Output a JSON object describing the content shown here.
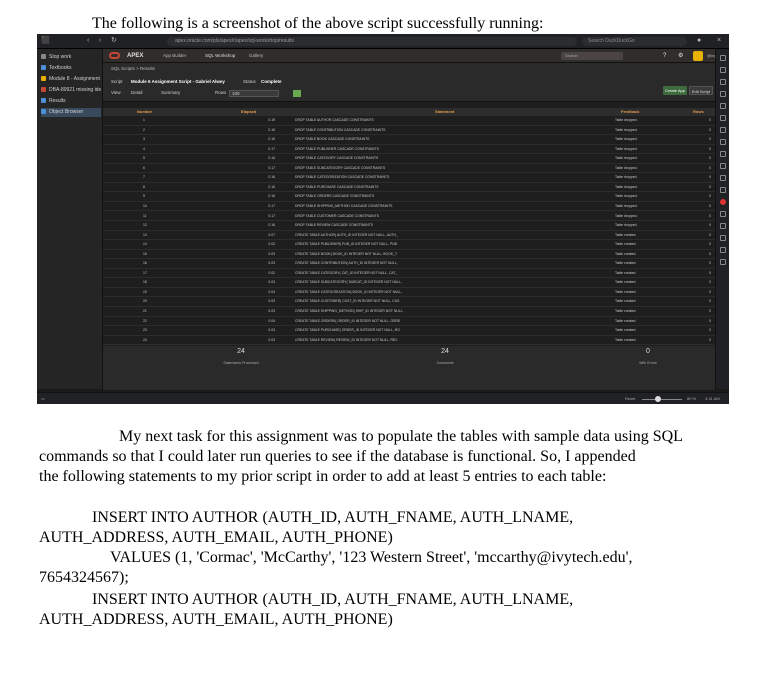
{
  "document": {
    "intro_line": "The following is a screenshot of the above script successfully running:",
    "paragraph_lines": [
      "My next task for this assignment was to populate the tables with sample data using SQL",
      "commands so that I could later run queries to see if the database is functional.  So, I appended",
      "the following statements to my prior script in order to add at least 5 entries to each table:"
    ],
    "code_lines": [
      "INSERT INTO AUTHOR (AUTH_ID, AUTH_FNAME, AUTH_LNAME,",
      "AUTH_ADDRESS, AUTH_EMAIL, AUTH_PHONE)",
      "VALUES (1, 'Cormac', 'McCarthy', '123 Western Street', 'mccarthy@ivytech.edu',",
      "7654324567);",
      "INSERT INTO AUTHOR (AUTH_ID, AUTH_FNAME, AUTH_LNAME,",
      "AUTH_ADDRESS, AUTH_EMAIL, AUTH_PHONE)"
    ]
  },
  "screenshot": {
    "browser": {
      "url": "apex.oracle.com/pls/apex/r/apex/sql-workshop/results",
      "search_placeholder": "Search DuckDuckGo",
      "workspace": "Stop work",
      "zoom": "80 %",
      "time": "3:31 AM"
    },
    "left_rail": {
      "items": [
        "Stop work",
        "Textbooks",
        "Module 8 - Assignment - S",
        "DBA-89921 missing ident",
        "Results",
        "Object Browser"
      ],
      "selected_index": 5
    },
    "apex": {
      "brand": "APEX",
      "nav": [
        "App Builder",
        "SQL Workshop",
        "Gallery"
      ],
      "search_placeholder": "Search",
      "user": "@ivytech.edu"
    },
    "breadcrumb": "SQL Scripts   >   Results",
    "meta": {
      "script_label": "Script",
      "script_value": "Module 6 Assignment Script - Gabriel Alwey",
      "status_label": "Status",
      "status_value": "Complete",
      "view_label": "View",
      "view_options": [
        "Detail",
        "Summary"
      ],
      "rows_label": "Rows",
      "rows_value": "100",
      "create_app_button": "Create App",
      "edit_script_button": "Edit Script"
    },
    "table": {
      "headers": [
        "Number",
        "Elapsed",
        "Statement",
        "Feedback",
        "Rows"
      ],
      "rows": [
        [
          "1",
          "0.19",
          "DROP TABLE AUTHOR CASCADE CONSTRAINTS",
          "Table dropped.",
          "0"
        ],
        [
          "2",
          "0.15",
          "DROP TABLE CONTRIBUTION CASCADE CONSTRAINTS",
          "Table dropped.",
          "0"
        ],
        [
          "3",
          "0.16",
          "DROP TABLE BOOK CASCADE CONSTRAINTS",
          "Table dropped.",
          "0"
        ],
        [
          "4",
          "0.17",
          "DROP TABLE PUBLISHER CASCADE CONSTRAINTS",
          "Table dropped.",
          "0"
        ],
        [
          "5",
          "0.16",
          "DROP TABLE CATEGORY CASCADE CONSTRAINTS",
          "Table dropped.",
          "0"
        ],
        [
          "6",
          "0.17",
          "DROP TABLE SUBCATEGORY CASCADE CONSTRAINTS",
          "Table dropped.",
          "0"
        ],
        [
          "7",
          "0.16",
          "DROP TABLE CATEGORIZATION CASCADE CONSTRAINTS",
          "Table dropped.",
          "0"
        ],
        [
          "8",
          "0.16",
          "DROP TABLE PURCHASE CASCADE CONSTRAINTS",
          "Table dropped.",
          "0"
        ],
        [
          "9",
          "0.16",
          "DROP TABLE ORDERS CASCADE CONSTRAINTS",
          "Table dropped.",
          "0"
        ],
        [
          "10",
          "0.17",
          "DROP TABLE SHIPPING_METHOD CASCADE CONSTRAINTS",
          "Table dropped.",
          "0"
        ],
        [
          "11",
          "0.17",
          "DROP TABLE CUSTOMER CASCADE CONSTRAINTS",
          "Table dropped.",
          "0"
        ],
        [
          "12",
          "0.16",
          "DROP TABLE REVIEW CASCADE CONSTRAINTS",
          "Table dropped.",
          "0"
        ],
        [
          "13",
          "0.07",
          "CREATE TABLE AUTHOR( AUTH_ID INTEGER NOT NULL, AUTH_",
          "Table created.",
          "0"
        ],
        [
          "14",
          "0.02",
          "CREATE TABLE PUBLISHER( PUB_ID INTEGER NOT NULL, PUB",
          "Table created.",
          "0"
        ],
        [
          "15",
          "0.03",
          "CREATE TABLE BOOK( BOOK_ID INTEGER NOT NULL, BOOK_T",
          "Table created.",
          "0"
        ],
        [
          "16",
          "0.03",
          "CREATE TABLE CONTRIBUTION( AUTH_ID INTEGER NOT NULL,",
          "Table created.",
          "0"
        ],
        [
          "17",
          "0.02",
          "CREATE TABLE CATEGORY( CAT_ID INTEGER NOT NULL, CAT_",
          "Table created.",
          "0"
        ],
        [
          "18",
          "0.03",
          "CREATE TABLE SUBCATEGORY( SUBCAT_ID INTEGER NOT NULL,",
          "Table created.",
          "0"
        ],
        [
          "19",
          "0.04",
          "CREATE TABLE CATEGORIZATION( BOOK_ID INTEGER NOT NULL,",
          "Table created.",
          "0"
        ],
        [
          "20",
          "0.03",
          "CREATE TABLE CUSTOMER( CUST_ID INTEGER NOT NULL, CUS",
          "Table created.",
          "0"
        ],
        [
          "21",
          "0.03",
          "CREATE TABLE SHIPPING_METHOD( SHIP_ID INTEGER NOT NULL,",
          "Table created.",
          "0"
        ],
        [
          "22",
          "0.04",
          "CREATE TABLE ORDERS( ORDER_ID INTEGER NOT NULL, ORDE",
          "Table created.",
          "0"
        ],
        [
          "23",
          "0.03",
          "CREATE TABLE PURCHASE( ORDER_ID INTEGER NOT NULL, RO",
          "Table created.",
          "0"
        ],
        [
          "24",
          "0.03",
          "CREATE TABLE REVIEW( REVIEW_ID INTEGER NOT NULL, REV",
          "Table created.",
          "0"
        ]
      ],
      "download_label": "Download",
      "pagination": "row(s) 1 - 24 of 24"
    },
    "totals": [
      {
        "value": "24",
        "label": "Statements Processed"
      },
      {
        "value": "24",
        "label": "Successful"
      },
      {
        "value": "0",
        "label": "With Errors"
      }
    ]
  }
}
